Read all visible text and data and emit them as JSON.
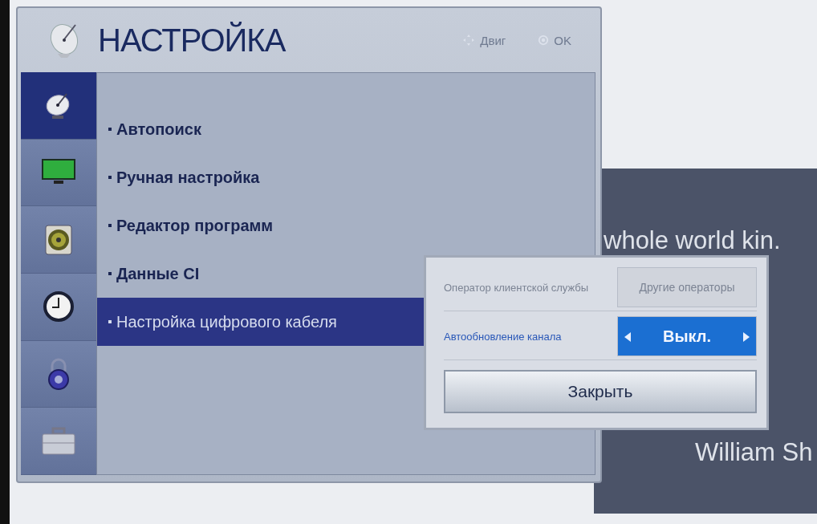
{
  "background": {
    "texts": [
      "whole world kin.",
      "William Sh"
    ]
  },
  "header": {
    "title": "НАСТРОЙКА",
    "hints": [
      {
        "kind": "move",
        "label": "Двиг"
      },
      {
        "kind": "ok",
        "label": "OK"
      }
    ]
  },
  "sidebar": {
    "items": [
      {
        "kind": "satellite",
        "selected": true
      },
      {
        "kind": "monitor",
        "selected": false
      },
      {
        "kind": "speaker",
        "selected": false
      },
      {
        "kind": "clock",
        "selected": false
      },
      {
        "kind": "lock",
        "selected": false
      },
      {
        "kind": "briefcase",
        "selected": false
      }
    ]
  },
  "menu": {
    "items": [
      {
        "label": "Автопоиск",
        "selected": false
      },
      {
        "label": "Ручная настройка",
        "selected": false
      },
      {
        "label": "Редактор программ",
        "selected": false
      },
      {
        "label": "Данные CI",
        "selected": false
      },
      {
        "label": "Настройка цифрового кабеля",
        "selected": true
      }
    ]
  },
  "dialog": {
    "rows": [
      {
        "label": "Оператор клиентской службы",
        "value": "Другие операторы",
        "disabled": true,
        "selected": false
      },
      {
        "label": "Автообновление канала",
        "value": "Выкл.",
        "disabled": false,
        "selected": true
      }
    ],
    "close_button": "Закрыть"
  }
}
